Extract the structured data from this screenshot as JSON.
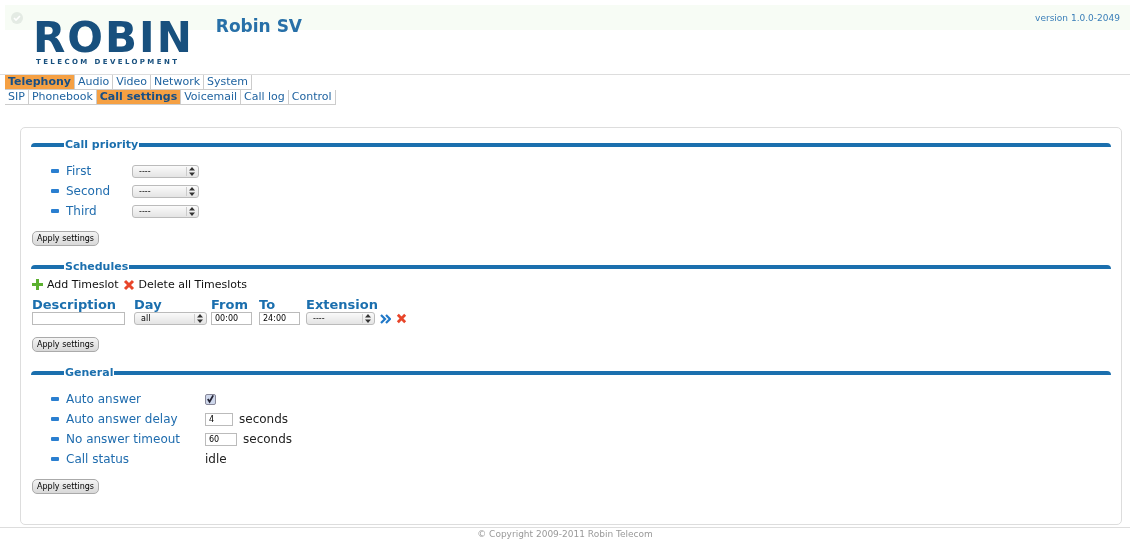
{
  "version": "version 1.0.0-2049",
  "logo": {
    "word": "ROBIN",
    "tagline": "TELECOM DEVELOPMENT"
  },
  "device_name": "Robin SV",
  "main_menu": [
    {
      "label": "Telephony",
      "selected": true
    },
    {
      "label": "Audio",
      "selected": false
    },
    {
      "label": "Video",
      "selected": false
    },
    {
      "label": "Network",
      "selected": false
    },
    {
      "label": "System",
      "selected": false
    }
  ],
  "sub_menu": [
    {
      "label": "SIP",
      "selected": false
    },
    {
      "label": "Phonebook",
      "selected": false
    },
    {
      "label": "Call settings",
      "selected": true
    },
    {
      "label": "Voicemail",
      "selected": false
    },
    {
      "label": "Call log",
      "selected": false
    },
    {
      "label": "Control",
      "selected": false
    }
  ],
  "call_priority": {
    "title": "Call priority",
    "rows": [
      {
        "label": "First",
        "value": "----"
      },
      {
        "label": "Second",
        "value": "----"
      },
      {
        "label": "Third",
        "value": "----"
      }
    ],
    "button": "Apply settings"
  },
  "schedules": {
    "title": "Schedules",
    "add": "Add Timeslot",
    "delete_all": "Delete all Timeslots",
    "columns": [
      "Description",
      "Day",
      "From",
      "To",
      "Extension"
    ],
    "row": {
      "day": "all",
      "from": "00:00",
      "to": "24:00",
      "extension": "----"
    },
    "button": "Apply settings"
  },
  "general": {
    "title": "General",
    "rows": [
      {
        "kind": "checkbox",
        "label": "Auto answer",
        "checked": true
      },
      {
        "kind": "number",
        "label": "Auto answer delay",
        "value": "4",
        "unit": "seconds"
      },
      {
        "kind": "number",
        "label": "No answer timeout",
        "value": "60",
        "unit": "seconds"
      },
      {
        "kind": "text",
        "label": "Call status",
        "value": "idle"
      }
    ],
    "button": "Apply settings"
  },
  "footer": "© Copyright 2009-2011 Robin Telecom"
}
